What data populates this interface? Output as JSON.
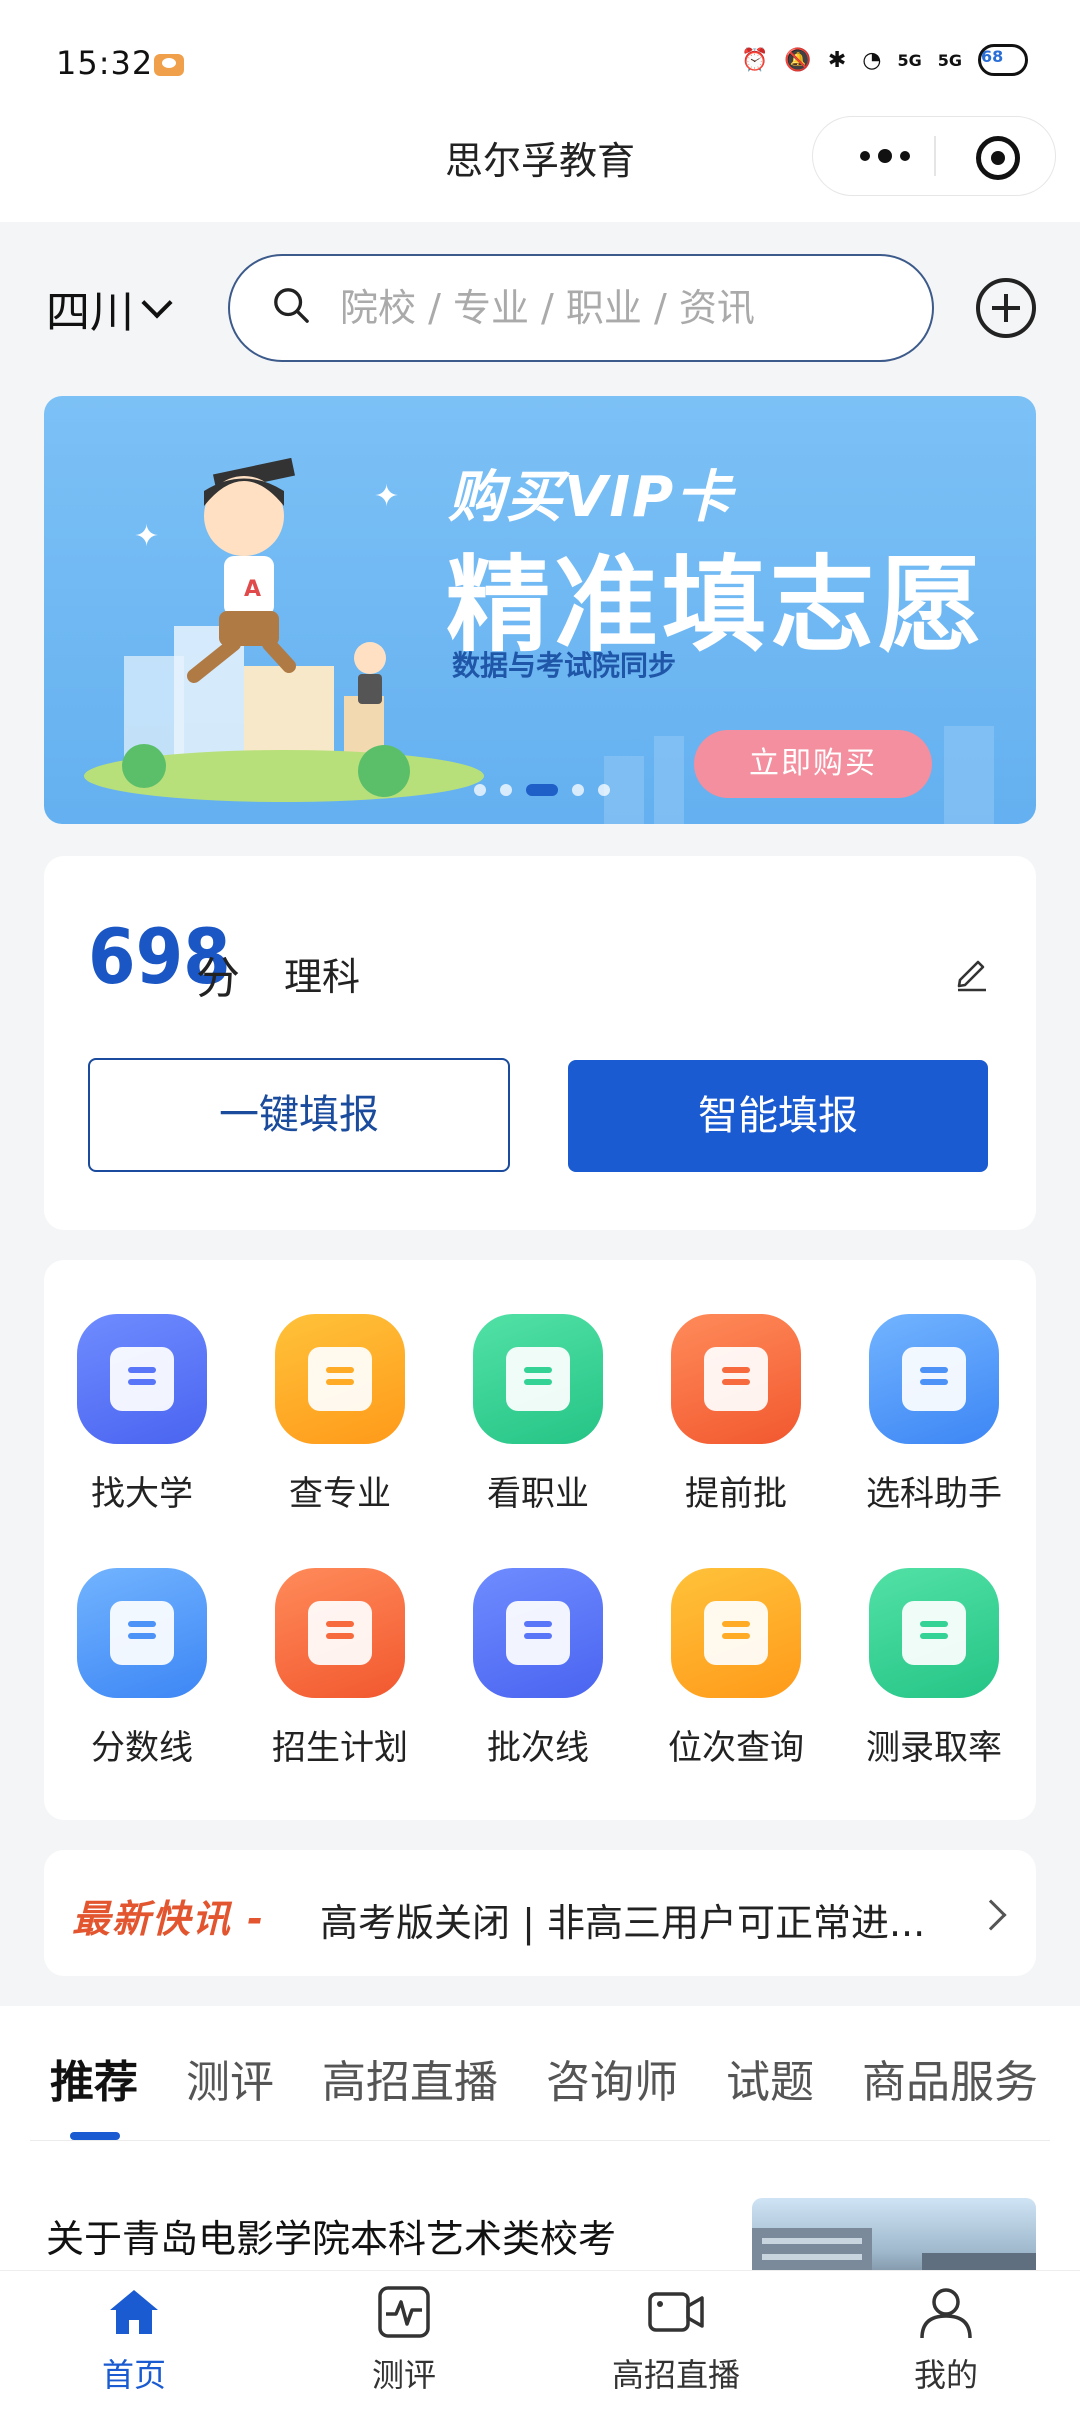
{
  "status_bar": {
    "time": "15:32",
    "signal_1": "5G",
    "signal_2": "5G",
    "battery": "68"
  },
  "header": {
    "title": "思尔孚教育"
  },
  "search": {
    "region": "四川",
    "placeholder": "院校 / 专业 / 职业 / 资讯"
  },
  "banner": {
    "line1": "购买VIP卡",
    "line2": "精准填志愿",
    "line3": "数据与考试院同步",
    "buy_label": "立即购买",
    "slide_count": 5,
    "active_slide": 3
  },
  "score": {
    "value": "698",
    "unit": "分",
    "subject": "理科",
    "one_click_label": "一键填报",
    "smart_label": "智能填报"
  },
  "features": [
    {
      "label": "找大学",
      "icon": "school-icon",
      "color": "#5a76f8"
    },
    {
      "label": "查专业",
      "icon": "major-book-icon",
      "color": "#ffab26"
    },
    {
      "label": "看职业",
      "icon": "briefcase-icon",
      "color": "#34d295"
    },
    {
      "label": "提前批",
      "icon": "chart-document-icon",
      "color": "#f76a3d"
    },
    {
      "label": "选科助手",
      "icon": "graduation-books-icon",
      "color": "#4d93f7"
    },
    {
      "label": "分数线",
      "icon": "score-line-icon",
      "color": "#4d93f7"
    },
    {
      "label": "招生计划",
      "icon": "enrollment-plan-icon",
      "color": "#f76a3d"
    },
    {
      "label": "批次线",
      "icon": "trend-line-icon",
      "color": "#5a76f8"
    },
    {
      "label": "位次查询",
      "icon": "map-pin-icon",
      "color": "#ffab26"
    },
    {
      "label": "测录取率",
      "icon": "percent-icon",
      "color": "#34d295"
    }
  ],
  "news": {
    "badge_main": "最新快讯",
    "badge_dash": "-",
    "text": "高考版关闭 | 非高三用户可正常进..."
  },
  "tabs": [
    "推荐",
    "测评",
    "高招直播",
    "咨询师",
    "试题",
    "商品服务"
  ],
  "active_tab": 0,
  "article": {
    "title": "关于青岛电影学院本科艺术类校考"
  },
  "bottom_nav": [
    {
      "label": "首页",
      "icon": "home-icon",
      "active": true
    },
    {
      "label": "测评",
      "icon": "assessment-icon",
      "active": false
    },
    {
      "label": "高招直播",
      "icon": "video-icon",
      "active": false
    },
    {
      "label": "我的",
      "icon": "profile-icon",
      "active": false
    }
  ],
  "colors": {
    "primary": "#1a5bd1",
    "score": "#1a56c4",
    "news_badge": "#e2552f",
    "banner_bg": "#6fb6f3",
    "buy_button": "#f38f9e"
  }
}
